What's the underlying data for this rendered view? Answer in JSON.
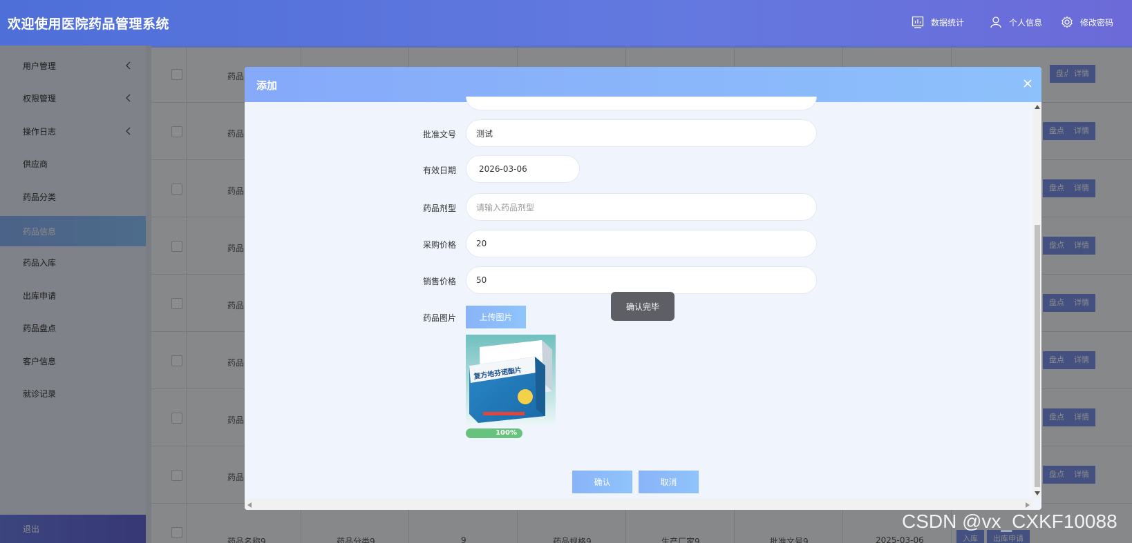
{
  "header": {
    "title": "欢迎使用医院药品管理系统",
    "nav_stats": "数据统计",
    "nav_profile": "个人信息",
    "nav_password": "修改密码"
  },
  "sidebar": {
    "items": [
      {
        "label": "用户管理",
        "has_arrow": true
      },
      {
        "label": "权限管理",
        "has_arrow": true
      },
      {
        "label": "操作日志",
        "has_arrow": true
      },
      {
        "label": "供应商",
        "has_arrow": false
      },
      {
        "label": "药品分类",
        "has_arrow": false
      },
      {
        "label": "药品信息",
        "has_arrow": false,
        "active": true
      },
      {
        "label": "药品入库",
        "has_arrow": false
      },
      {
        "label": "出库申请",
        "has_arrow": false
      },
      {
        "label": "药品盘点",
        "has_arrow": false
      },
      {
        "label": "客户信息",
        "has_arrow": false
      },
      {
        "label": "就诊记录",
        "has_arrow": false
      }
    ],
    "logout": "退出"
  },
  "table": {
    "row_prefix": "药品",
    "last_row": [
      "药品名称9",
      "药品分类9",
      "9",
      "药品规格9",
      "生产厂家9",
      "批准文号9",
      "2025-03-06"
    ],
    "btn_check": "盘点",
    "btn_detail": "详情",
    "btn_in": "入库",
    "btn_out": "出库申请"
  },
  "modal": {
    "title": "添加",
    "fields": {
      "approval_label": "批准文号",
      "approval_value": "测试",
      "expiry_label": "有效日期",
      "expiry_value": "2026-03-06",
      "dosage_label": "药品剂型",
      "dosage_placeholder": "请输入药品剂型",
      "purchase_label": "采购价格",
      "purchase_value": "20",
      "sale_label": "销售价格",
      "sale_value": "50",
      "image_label": "药品图片"
    },
    "upload_button": "上传图片",
    "upload_progress": "100%",
    "upload_progress_value": 1.0,
    "toast": "确认完毕",
    "confirm": "确认",
    "cancel": "取消",
    "product_text": "复方地芬诺酯片"
  },
  "watermark": "CSDN @vx_CXKF10088",
  "colors": {
    "header_start": "#4e6fd8",
    "header_end": "#6c6ad8",
    "accent": "#8ab3f8",
    "progress": "#67c27d"
  }
}
